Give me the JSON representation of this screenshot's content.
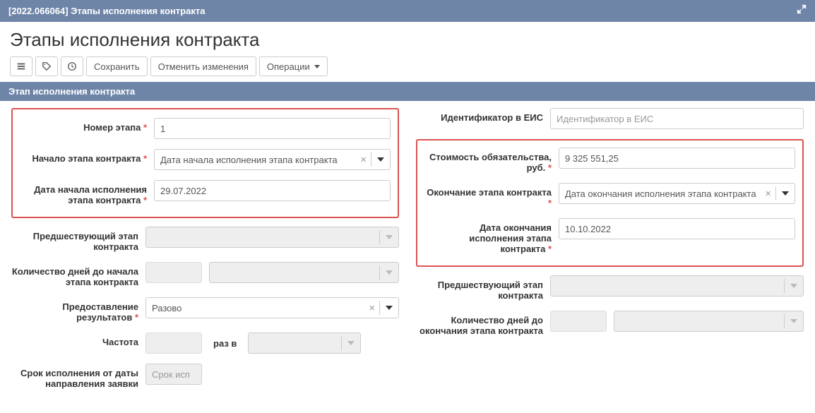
{
  "window": {
    "title": "[2022.066064] Этапы исполнения контракта"
  },
  "page": {
    "title": "Этапы исполнения контракта"
  },
  "toolbar": {
    "save": "Сохранить",
    "cancel": "Отменить изменения",
    "operations": "Операции"
  },
  "section": {
    "title": "Этап исполнения контракта"
  },
  "labels": {
    "stage_number": "Номер этапа",
    "contract_start": "Начало этапа контракта",
    "exec_start_date": "Дата начала исполнения этапа контракта",
    "prev_stage": "Предшествующий этап контракта",
    "days_to_start": "Количество дней до начала этапа контракта",
    "provision": "Предоставление результатов",
    "frequency": "Частота",
    "freq_mid": "раз в",
    "deadline_from_request": "Срок исполнения от даты направления заявки",
    "eis_id": "Идентификатор в ЕИС",
    "obligation_cost": "Стоимость обязательства, руб.",
    "contract_end": "Окончание этапа контракта",
    "exec_end_date": "Дата окончания исполнения этапа контракта",
    "prev_stage_r": "Предшествующий этап контракта",
    "days_to_end": "Количество дней до окончания этапа контракта"
  },
  "values": {
    "stage_number": "1",
    "contract_start_select": "Дата начала исполнения этапа контракта",
    "exec_start_date": "29.07.2022",
    "provision_select": "Разово",
    "deadline_placeholder": "Срок исп",
    "eis_placeholder": "Идентификатор в ЕИС",
    "obligation_cost": "9 325 551,25",
    "contract_end_select": "Дата окончания исполнения этапа контракта",
    "exec_end_date": "10.10.2022"
  }
}
